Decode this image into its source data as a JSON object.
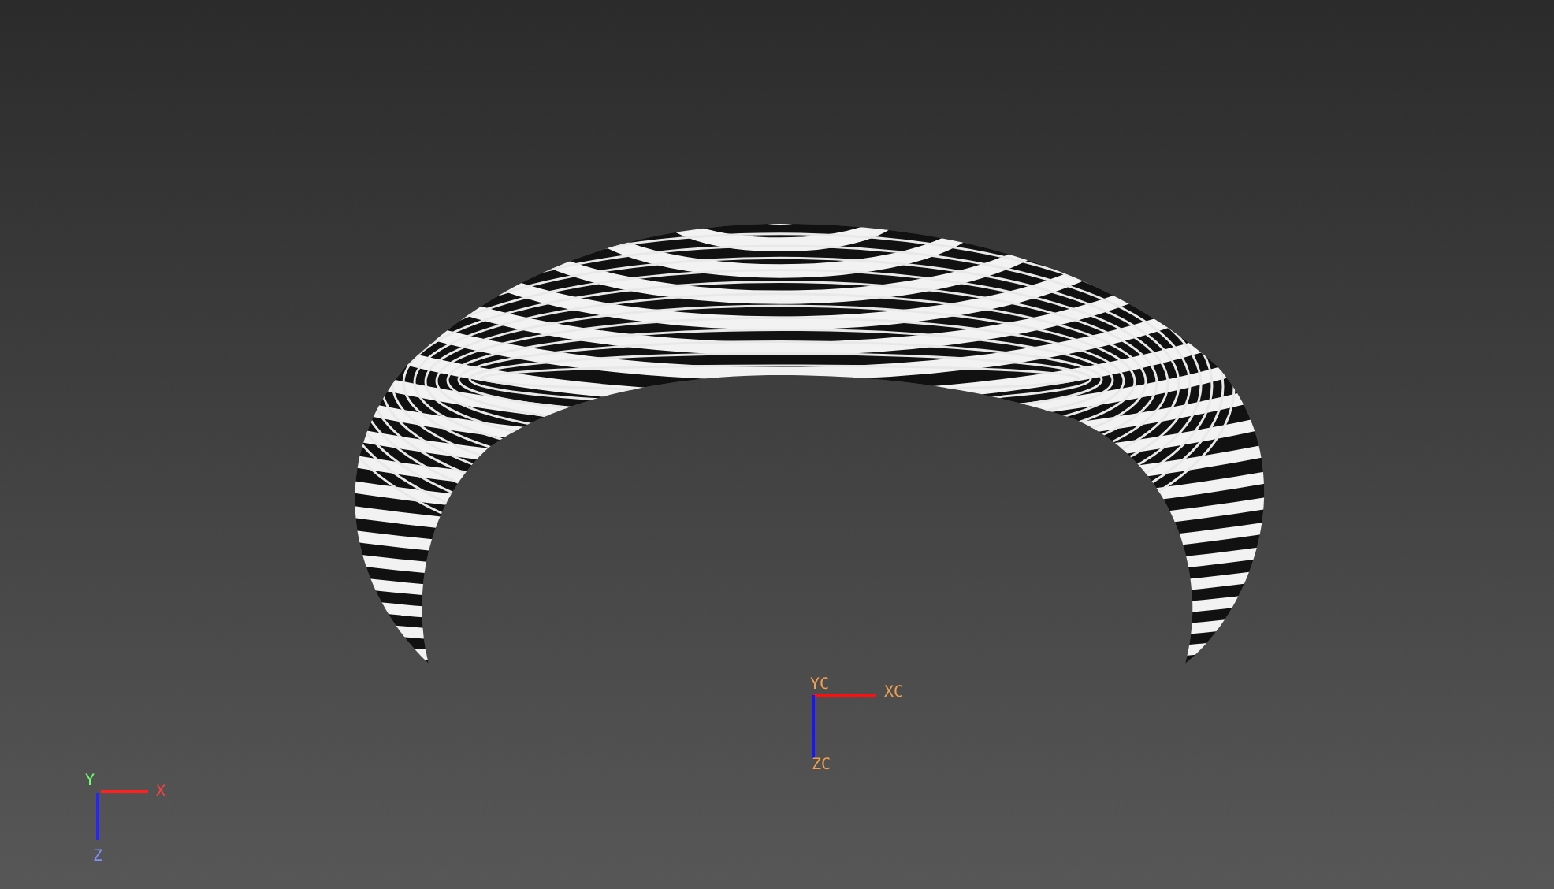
{
  "viewport": {
    "work_axes": {
      "y_label": "YC",
      "x_label": "XC",
      "z_label": "ZC"
    },
    "view_triad": {
      "y_label": "Y",
      "x_label": "X",
      "z_label": "Z"
    }
  }
}
